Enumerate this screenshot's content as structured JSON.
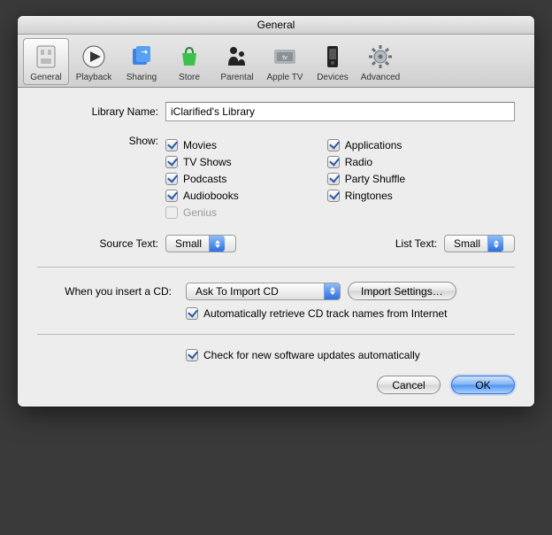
{
  "window": {
    "title": "General"
  },
  "toolbar": {
    "items": [
      {
        "label": "General"
      },
      {
        "label": "Playback"
      },
      {
        "label": "Sharing"
      },
      {
        "label": "Store"
      },
      {
        "label": "Parental"
      },
      {
        "label": "Apple TV"
      },
      {
        "label": "Devices"
      },
      {
        "label": "Advanced"
      }
    ]
  },
  "library": {
    "label": "Library Name:",
    "value": "iClarified's Library"
  },
  "show": {
    "label": "Show:",
    "left": [
      {
        "label": "Movies",
        "checked": true
      },
      {
        "label": "TV Shows",
        "checked": true
      },
      {
        "label": "Podcasts",
        "checked": true
      },
      {
        "label": "Audiobooks",
        "checked": true
      },
      {
        "label": "Genius",
        "checked": false,
        "disabled": true
      }
    ],
    "right": [
      {
        "label": "Applications",
        "checked": true
      },
      {
        "label": "Radio",
        "checked": true
      },
      {
        "label": "Party Shuffle",
        "checked": true
      },
      {
        "label": "Ringtones",
        "checked": true
      }
    ]
  },
  "sourceText": {
    "label": "Source Text:",
    "value": "Small"
  },
  "listText": {
    "label": "List Text:",
    "value": "Small"
  },
  "cd": {
    "label": "When you insert a CD:",
    "value": "Ask To Import CD",
    "importSettingsLabel": "Import Settings…",
    "autoRetrieve": "Automatically retrieve CD track names from Internet"
  },
  "updates": {
    "label": "Check for new software updates automatically"
  },
  "buttons": {
    "cancel": "Cancel",
    "ok": "OK"
  }
}
